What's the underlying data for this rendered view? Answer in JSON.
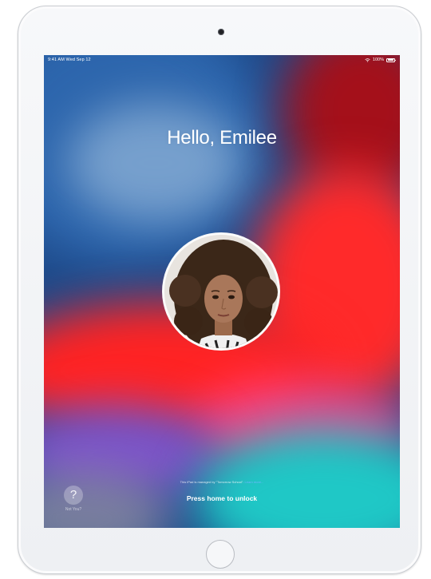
{
  "status_bar": {
    "time_date": "9:41 AM  Wed Sep 12",
    "battery": "100%"
  },
  "lock_screen": {
    "greeting": "Hello, Emilee",
    "managed_notice": "This iPad is managed by \"Tomorrow School\".",
    "learn_more": "Learn more...",
    "unlock_hint": "Press home to unlock",
    "not_you_label": "Not You?",
    "not_you_symbol": "?"
  },
  "icons": [
    "wifi-icon",
    "battery-icon",
    "question-mark-icon",
    "home-button"
  ],
  "colors": {
    "wallpaper_blue": "#2f63a6",
    "wallpaper_red": "#ff2b2b",
    "wallpaper_teal": "#20c7c5",
    "link": "#6fb6ff"
  }
}
